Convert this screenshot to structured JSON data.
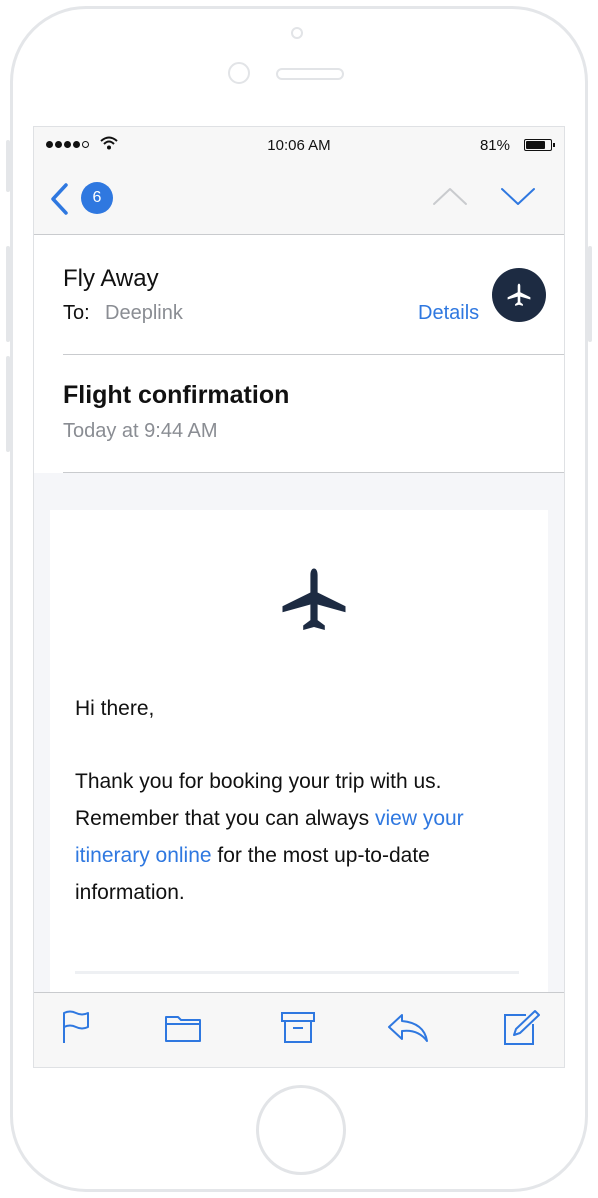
{
  "status_bar": {
    "time": "10:06 AM",
    "battery_percent": "81%",
    "battery_level": 0.81,
    "signal_bars": 4
  },
  "nav": {
    "unread_count": "6",
    "icons": [
      "chevron-left-icon",
      "chevron-up-icon",
      "chevron-down-icon"
    ]
  },
  "header": {
    "sender": "Fly Away",
    "to_label": "To:",
    "to_value": "Deeplink",
    "details_label": "Details",
    "avatar_icon": "airplane-icon"
  },
  "message": {
    "subject": "Flight confirmation",
    "date": "Today at 9:44 AM",
    "greeting": "Hi there,",
    "body_before_link": "Thank you for booking your trip with us. Remember that you can always ",
    "link_text": "view your itinerary online",
    "body_after_link": " for the most up-to-date information."
  },
  "toolbar": {
    "icons": [
      "flag-icon",
      "folder-icon",
      "archive-icon",
      "reply-icon",
      "compose-icon"
    ]
  },
  "colors": {
    "accent": "#2f78e0",
    "avatar_bg": "#1d2b42",
    "plane": "#1d2b42"
  }
}
